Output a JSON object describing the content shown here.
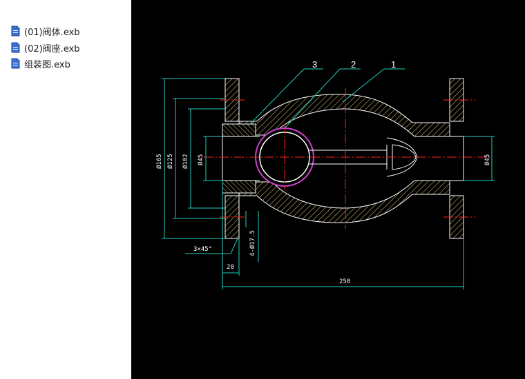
{
  "files": [
    {
      "name": "(01)阀体.exb"
    },
    {
      "name": "(02)阀座.exb"
    },
    {
      "name": "组装图.exb"
    }
  ],
  "colors": {
    "canvas": "#000000",
    "panel": "#ffffff",
    "outline": "#ffffff",
    "hatch": "#c8b46a",
    "centerline": "#ff2020",
    "dimension": "#20d0c0",
    "leader": "#20d0c0",
    "ball": "#d040d0"
  },
  "drawing": {
    "part_labels": [
      "3",
      "2",
      "1"
    ],
    "dimensions": {
      "d165": "Ø165",
      "d125": "Ø125",
      "d102": "Ø102",
      "d45_left": "Ø45",
      "d45_right": "Ø45",
      "chamfer": "3×45°",
      "bolt_holes": "4-Ø17.5",
      "flange_thickness": "20",
      "overall_length": "250"
    }
  }
}
